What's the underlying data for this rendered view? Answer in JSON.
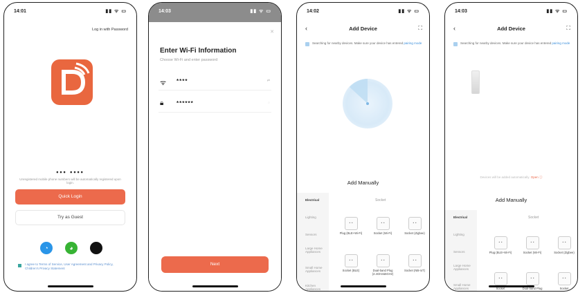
{
  "screen1": {
    "time": "14:01",
    "status_icons": "▮▮ ᯤ ▭",
    "login_password_link": "Log in with Password",
    "phone_number": "••• ••••",
    "terms_small": "Unregistered mobile phone numbers will be automatically registered upon login.",
    "quick_login": "Quick Login",
    "try_guest": "Try as Guest",
    "agreement": "I agree to Terms of Service, User Agreement and Privacy Policy, Children's Privacy Statement"
  },
  "screen2": {
    "time": "14:03",
    "status_icons": "▮▮ ᯤ ▭",
    "close": "✕",
    "title": "Enter Wi-Fi Information",
    "subtitle": "Choose Wi-Fi and enter password",
    "wifi_value": "****",
    "password_value": "******",
    "wifi_hint": "⇄",
    "password_hint": "◌",
    "next": "Next"
  },
  "screen3": {
    "time": "14:02",
    "status_icons": "▮▮ ᯤ ▭",
    "title": "Add Device",
    "search_text": "Searching for nearby devices. Make sure your device has entered",
    "search_link": "pairing mode",
    "add_manually": "Add Manually",
    "tab_electrical": "Electrical",
    "tab_socket": "Socket",
    "categories": [
      "Lighting",
      "Sensors",
      "Large Home Appliances",
      "Small Home Appliances",
      "Kitchen Appliances"
    ],
    "devices": [
      {
        "name": "Plug (BLE+Wi-Fi)",
        "icon": "▪ ▪"
      },
      {
        "name": "Socket (Wi-Fi)",
        "icon": "▪ ▪"
      },
      {
        "name": "Socket (Zigbee)",
        "icon": "▪ ▪"
      },
      {
        "name": "Socket (BLE)",
        "icon": "▪ ▪"
      },
      {
        "name": "Dual-band Plug (2.4GHz&5GHz)",
        "icon": "▪ ▪"
      },
      {
        "name": "Socket (NB-IoT)",
        "icon": "▪ ▪"
      }
    ]
  },
  "screen4": {
    "time": "14:03",
    "status_icons": "▮▮ ᯤ ▭",
    "title": "Add Device",
    "search_text": "Searching for nearby devices. Make sure your device has entered",
    "search_link": "pairing mode",
    "not_detected": "Devices will be added automatically.",
    "not_detected_link": "Open ⓘ",
    "add_manually": "Add Manually",
    "tab_electrical": "Electrical",
    "tab_socket": "Socket",
    "categories": [
      "Lighting",
      "Sensors",
      "Large Home Appliances",
      "Small Home Appliances"
    ],
    "devices": [
      {
        "name": "Plug (BLE+Wi-Fi)",
        "icon": "▪ ▪"
      },
      {
        "name": "Socket (Wi-Fi)",
        "icon": "▪ ▪"
      },
      {
        "name": "Socket (Zigbee)",
        "icon": "▪ ▪"
      },
      {
        "name": "Socket",
        "icon": "▪ ▪"
      },
      {
        "name": "Dual-band Plug",
        "icon": "▪ ▪"
      },
      {
        "name": "Socket",
        "icon": "▪ ▪"
      }
    ]
  },
  "colors": {
    "accent": "#ec6a4c",
    "link": "#3b8fdb",
    "qq": "#2a95e8",
    "wechat": "#37b334",
    "apple": "#111111"
  },
  "icons": [
    "logo-d-icon",
    "wifi-icon",
    "lock-icon",
    "back-icon",
    "scan-icon",
    "qq-icon",
    "wechat-icon",
    "apple-icon",
    "checkbox-icon",
    "socket-icon"
  ]
}
